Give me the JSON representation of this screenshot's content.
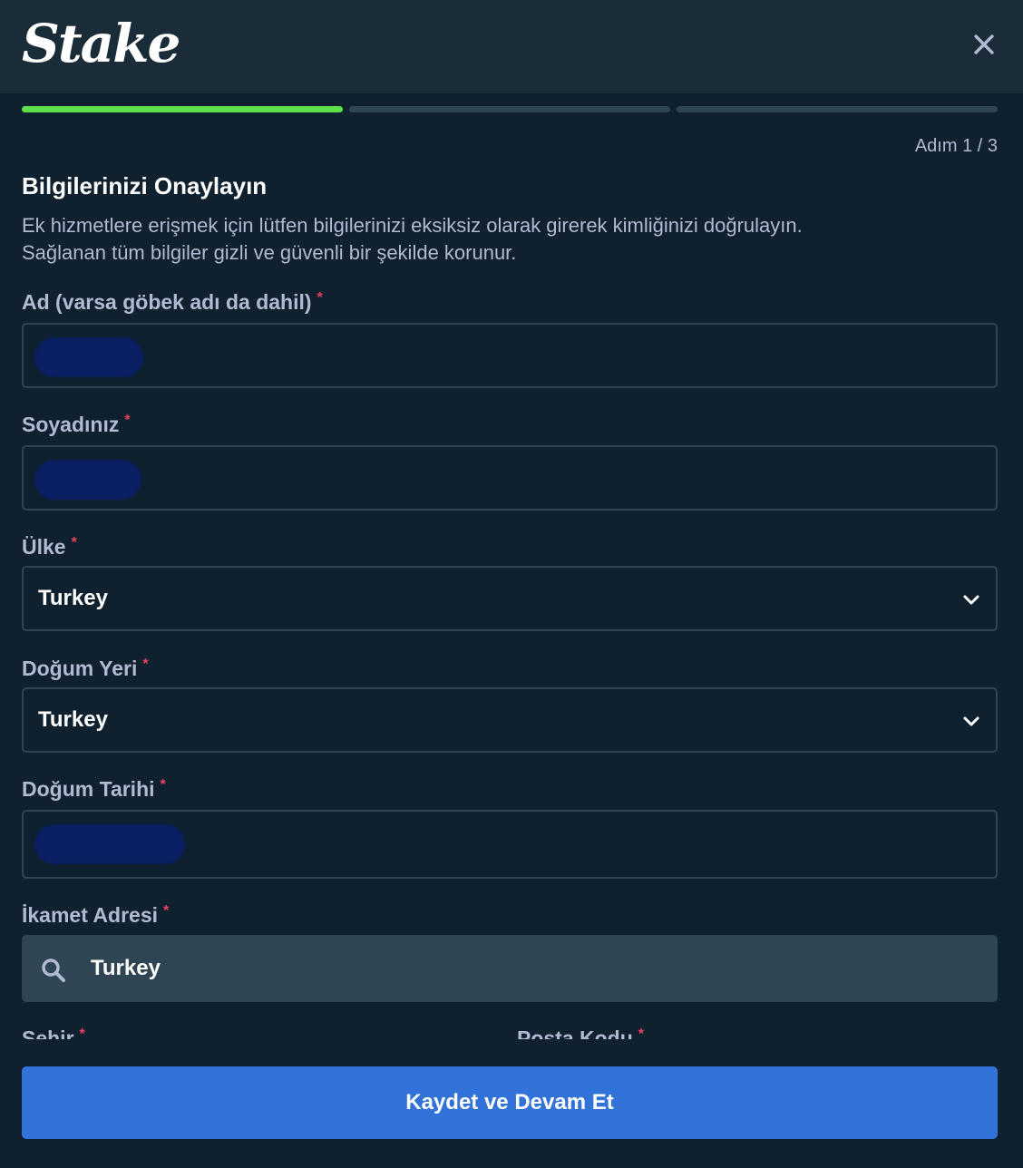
{
  "header": {
    "logo_text": "Stake",
    "close_icon": "close-icon"
  },
  "progress": {
    "current_step": 1,
    "total_steps": 3,
    "step_label": "Adım 1 / 3"
  },
  "form": {
    "title": "Bilgilerinizi Onaylayın",
    "description_line1": "Ek hizmetlere erişmek için lütfen bilgilerinizi eksiksiz olarak girerek kimliğinizi doğrulayın.",
    "description_line2": "Sağlanan tüm bilgiler gizli ve güvenli bir şekilde korunur.",
    "required_mark": "*",
    "first_name": {
      "label": "Ad (varsa göbek adı da dahil)",
      "value": ""
    },
    "last_name": {
      "label": "Soyadınız",
      "value": ""
    },
    "country": {
      "label": "Ülke",
      "value": "Turkey"
    },
    "birth_place": {
      "label": "Doğum Yeri",
      "value": "Turkey"
    },
    "birth_date": {
      "label": "Doğum Tarihi",
      "value": ""
    },
    "address": {
      "label": "İkamet Adresi",
      "value": "Turkey",
      "icon": "search-icon"
    },
    "city": {
      "label": "Şehir"
    },
    "postal_code": {
      "label": "Posta Kodu"
    },
    "submit_label": "Kaydet ve Devam Et"
  },
  "colors": {
    "progress_active": "#5ee04d",
    "progress_inactive": "#2f4553",
    "required": "#ed4163",
    "primary_button": "#3273d9",
    "redaction": "#0a1f64"
  }
}
